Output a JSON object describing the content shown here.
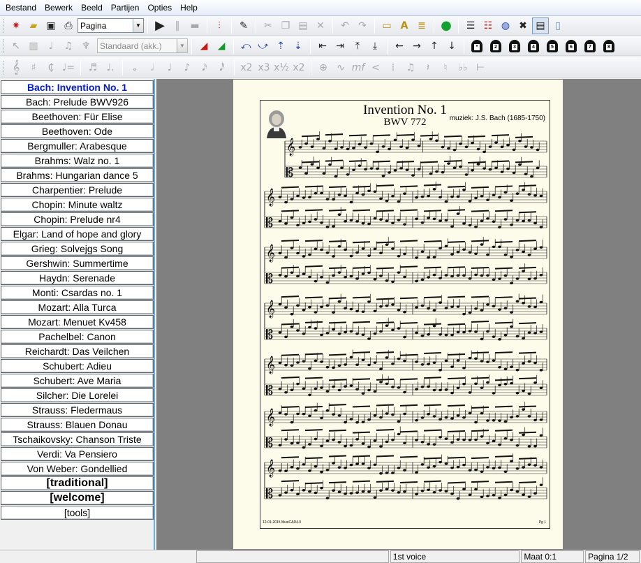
{
  "menu": [
    "Bestand",
    "Bewerk",
    "Beeld",
    "Partijen",
    "Opties",
    "Help"
  ],
  "toolbar": {
    "view_select": "Pagina",
    "style_select": "Standaard (akk.)"
  },
  "songs": [
    {
      "label": "Bach: Invention No. 1",
      "active": true
    },
    {
      "label": "Bach: Prelude BWV926"
    },
    {
      "label": "Beethoven: Für Elise"
    },
    {
      "label": "Beethoven: Ode"
    },
    {
      "label": "Bergmuller: Arabesque"
    },
    {
      "label": "Brahms: Walz no. 1"
    },
    {
      "label": "Brahms: Hungarian dance 5"
    },
    {
      "label": "Charpentier: Prelude"
    },
    {
      "label": "Chopin: Minute waltz"
    },
    {
      "label": "Chopin: Prelude nr4"
    },
    {
      "label": "Elgar: Land of hope and glory"
    },
    {
      "label": "Grieg: Solvejgs Song"
    },
    {
      "label": "Gershwin: Summertime"
    },
    {
      "label": "Haydn: Serenade"
    },
    {
      "label": "Monti: Csardas no. 1"
    },
    {
      "label": "Mozart: Alla Turca"
    },
    {
      "label": "Mozart: Menuet Kv458"
    },
    {
      "label": "Pachelbel: Canon"
    },
    {
      "label": "Reichardt: Das Veilchen"
    },
    {
      "label": "Schubert: Adieu"
    },
    {
      "label": "Schubert: Ave Maria"
    },
    {
      "label": "Silcher: Die Lorelei"
    },
    {
      "label": "Strauss: Fledermaus"
    },
    {
      "label": "Strauss: Blauen Donau"
    },
    {
      "label": "Tschaikovsky: Chanson Triste"
    },
    {
      "label": "Verdi: Va Pensiero"
    },
    {
      "label": "Von Weber: Gondellied"
    },
    {
      "label": "[traditional]",
      "bold": true
    },
    {
      "label": "[welcome]",
      "bold": true
    },
    {
      "label": "[tools]"
    }
  ],
  "score": {
    "title": "Invention No. 1",
    "subtitle": "BWV 772",
    "composer": "muziek: J.S. Bach (1685-1750)",
    "footer_left": "12-01-2015  MusiCAD4.0",
    "footer_right": "Pg 1",
    "time_signature": "4/4"
  },
  "status": {
    "voice": "1st voice",
    "measure": "Maat 0:1",
    "page": "Pagina 1/2"
  },
  "icons": {
    "toolbar1": [
      "new-file-icon",
      "open-folder-icon",
      "save-icon",
      "print-icon",
      "play-icon",
      "pause-icon",
      "stop-icon",
      "mixer-icon",
      "edit-pen-icon",
      "cut-icon",
      "copy-icon",
      "paste-icon",
      "delete-icon",
      "undo-icon",
      "redo-icon",
      "folder-icon",
      "text-icon",
      "notes-folder-icon",
      "record-icon",
      "staff-view-icon",
      "staff-lines-icon",
      "globe-icon",
      "tools-icon",
      "score-view-icon",
      "panel-icon"
    ],
    "colors": {
      "accent_blue": "#0019d6",
      "record_green": "#15a132",
      "canvas_gray": "#808080",
      "paper": "#fdfbe9"
    }
  }
}
